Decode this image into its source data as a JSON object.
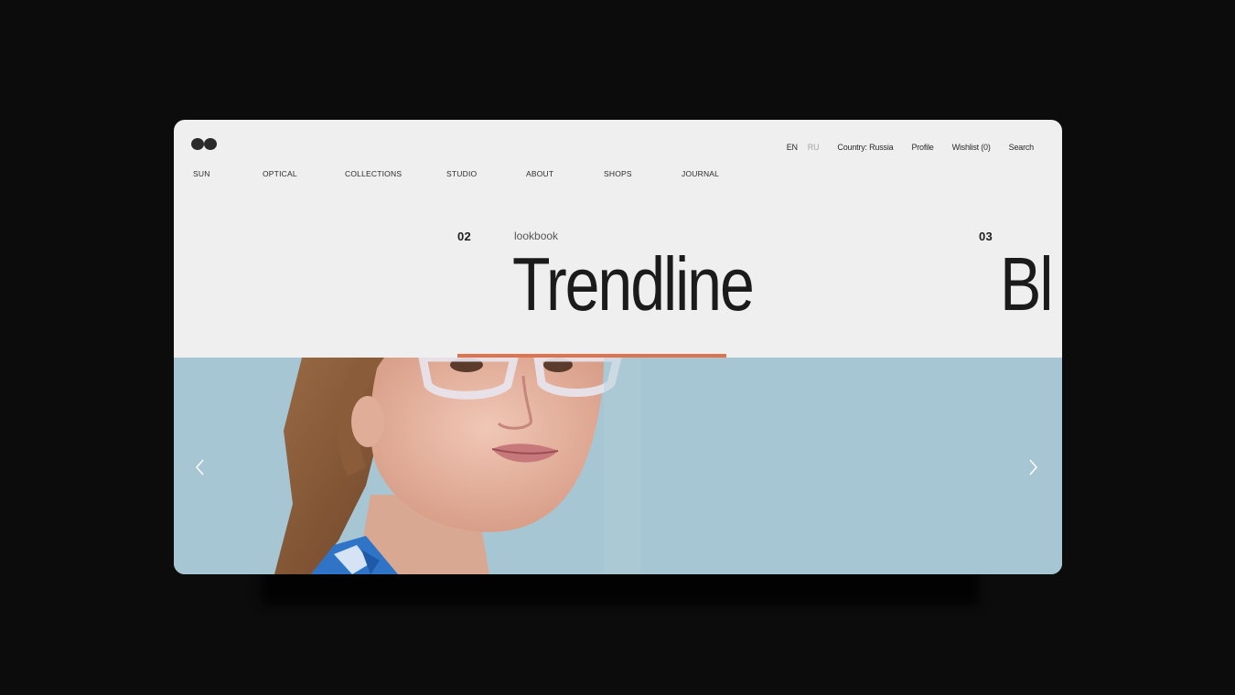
{
  "header": {
    "languages": {
      "active": "EN",
      "inactive": "RU"
    },
    "country": "Country: Russia",
    "profile": "Profile",
    "wishlist": "Wishlist (0)",
    "search": "Search"
  },
  "nav": {
    "items": [
      {
        "label": "SUN"
      },
      {
        "label": "OPTICAL"
      },
      {
        "label": "COLLECTIONS"
      },
      {
        "label": "STUDIO"
      },
      {
        "label": "ABOUT"
      },
      {
        "label": "SHOPS"
      },
      {
        "label": "JOURNAL"
      }
    ]
  },
  "slider": {
    "current": {
      "number": "02",
      "kicker": "lookbook",
      "title": "Trendline"
    },
    "next": {
      "number": "03",
      "title": "Bl"
    },
    "progress": 1.0
  },
  "icons": {
    "logo": "logo-glasses-icon",
    "prev": "chevron-left-icon",
    "next": "chevron-right-icon"
  },
  "colors": {
    "accent": "#e0734f",
    "hero_bg": "#a7c6d4",
    "page_bg": "#efefef"
  }
}
